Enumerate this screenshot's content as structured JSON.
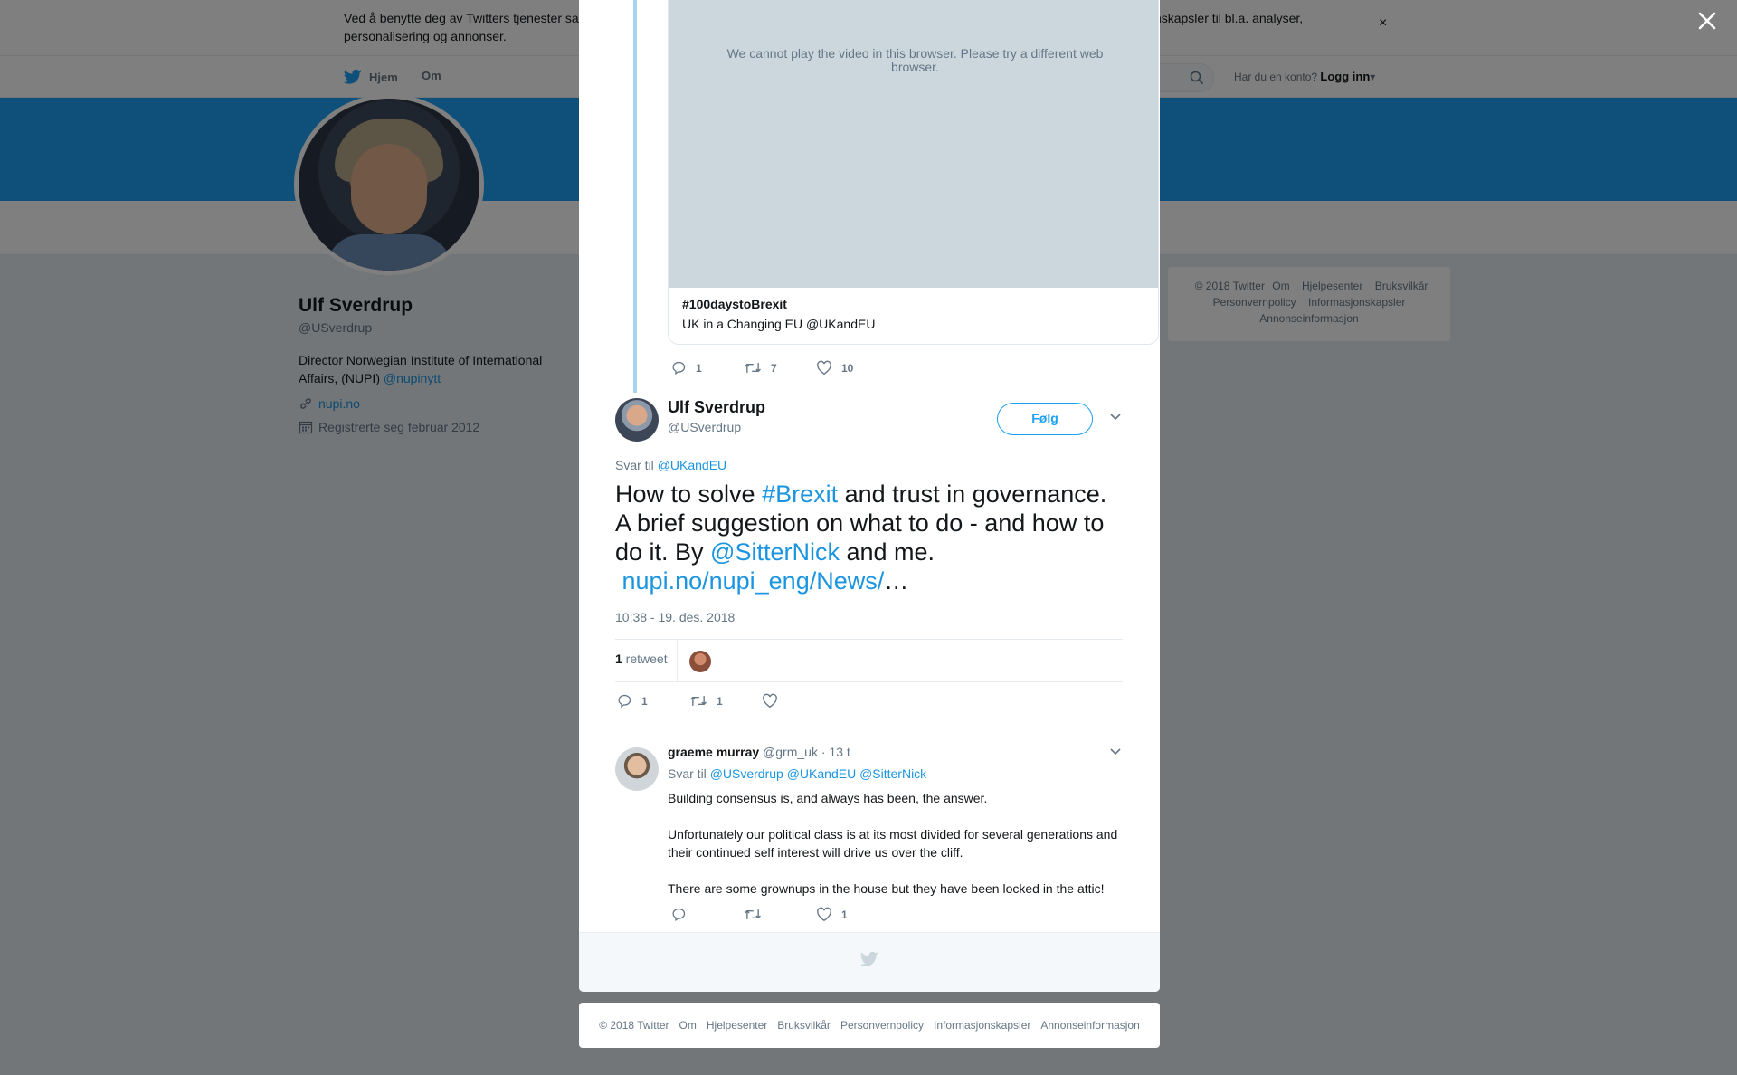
{
  "cookie_bar": {
    "text": "Ved å benytte deg av Twitters tjenester samtykker du i vår bruk av informasjonskapsler. Vi og våre partnere opererer globalt og bruker informasjonskapsler til bl.a. analyser, personalisering og annonser.",
    "close": "×"
  },
  "nav": {
    "home": "Hjem",
    "about": "Om",
    "account_prompt": "Har du en konto?",
    "login": "Logg inn"
  },
  "profile": {
    "name": "Ulf Sverdrup",
    "handle": "@USverdrup",
    "bio": "Director Norwegian Institute of International Affairs, (NUPI) ",
    "bio_mention": "@nupinytt",
    "website": "nupi.no",
    "joined": "Registrerte seg februar 2012"
  },
  "side_footer": {
    "items": [
      "© 2018 Twitter",
      "Om",
      "Hjelpesenter",
      "Bruksvilkår",
      "Personvernpolicy",
      "Informasjonskapsler",
      "Annonseinformasjon"
    ]
  },
  "video_card": {
    "message": "We cannot play the video in this browser. Please try a different web browser.",
    "title": "#100daystoBrexit",
    "description": "UK in a Changing EU @UKandEU"
  },
  "prev_tweet_actions": {
    "replies": "1",
    "retweets": "7",
    "likes": "10"
  },
  "main_tweet": {
    "name": "Ulf Sverdrup",
    "handle": "@USverdrup",
    "follow": "Følg",
    "reply_prefix": "Svar til ",
    "reply_to": "@UKandEU",
    "text_1": "How to solve ",
    "hashtag": "#Brexit",
    "text_2": " and trust in governance. A brief suggestion on what to do - and how to do it. By ",
    "mention": "@SitterNick",
    "text_3": " and me.",
    "link": "nupi.no/nupi_eng/News/",
    "ellipsis": "…",
    "timestamp": "10:38 - 19. des. 2018",
    "retweet_count": "1",
    "retweet_label": " retweet",
    "actions": {
      "replies": "1",
      "retweets": "1",
      "likes": ""
    }
  },
  "reply_tweet": {
    "name": "graeme murray",
    "handle": "@grm_uk",
    "time": "· 13 t",
    "reply_prefix": "Svar til ",
    "mentions": [
      "@USverdrup",
      "@UKandEU",
      "@SitterNick"
    ],
    "paragraphs": [
      "Building consensus is, and always has been, the answer.",
      "Unfortunately our political class is at its most divided for several generations and their continued self interest will drive us over the cliff.",
      "There are some grownups in the house but they have been locked in the attic!"
    ],
    "actions": {
      "replies": "",
      "retweets": "",
      "likes": "1"
    }
  },
  "bottom_footer": {
    "items": [
      "© 2018 Twitter",
      "Om",
      "Hjelpesenter",
      "Bruksvilkår",
      "Personvernpolicy",
      "Informasjonskapsler",
      "Annonseinformasjon"
    ]
  },
  "colors": {
    "brand": "#1da1f2",
    "link": "#1b95e0",
    "muted": "#657786",
    "overlay": "rgba(0,0,0,0.5)"
  },
  "icons": [
    "twitter-bird-icon",
    "search-icon",
    "link-icon",
    "calendar-icon",
    "reply-icon",
    "retweet-icon",
    "heart-icon",
    "chevron-down-icon",
    "close-icon"
  ]
}
